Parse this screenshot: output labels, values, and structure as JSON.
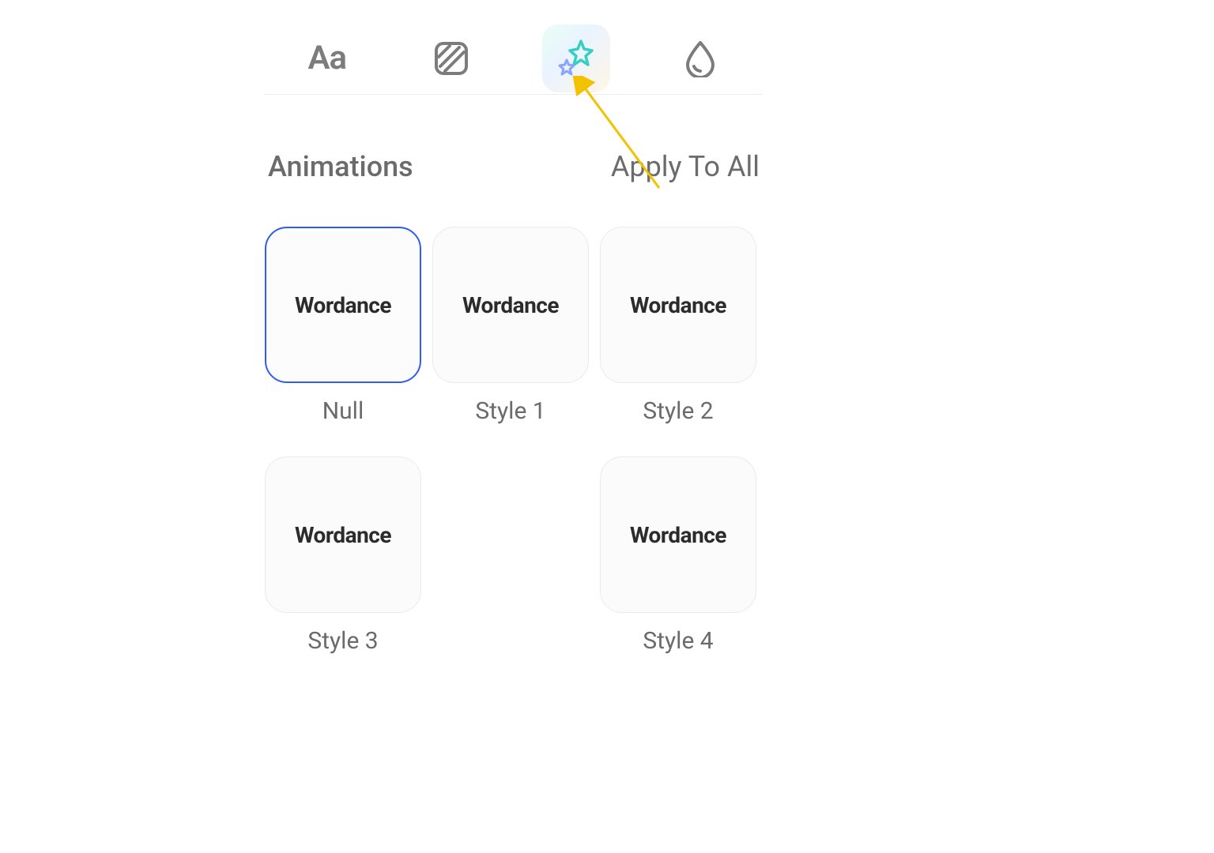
{
  "tabs": {
    "text_icon_label": "Aa",
    "texture_icon_name": "hatch-square-icon",
    "animation_icon_name": "sparkle-stars-icon",
    "drop_icon_name": "water-drop-icon",
    "active_index": 2
  },
  "header": {
    "title": "Animations",
    "apply_all": "Apply To All"
  },
  "preview_word": "Wordance",
  "styles": [
    {
      "preview": "Wordance",
      "caption": "Null",
      "selected": true
    },
    {
      "preview": "Wordance",
      "caption": "Style 1",
      "selected": false
    },
    {
      "preview": "Wordance",
      "caption": "Style 2",
      "selected": false
    },
    {
      "preview": "Wordance",
      "caption": "Style 3",
      "selected": false
    },
    {
      "preview": "Wordance",
      "caption": "Style 4",
      "selected": false
    }
  ],
  "colors": {
    "selection_border": "#2f5df0",
    "star_big": "#34d0c3",
    "star_small": "#8aa4ff",
    "arrow": "#f2c200"
  }
}
